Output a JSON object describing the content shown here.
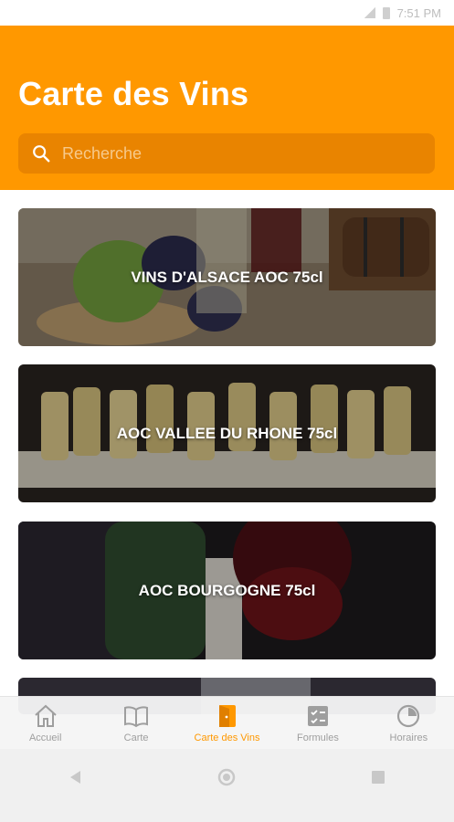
{
  "status_bar": {
    "time": "7:51 PM"
  },
  "header": {
    "title": "Carte des Vins",
    "search_placeholder": "Recherche",
    "color": "#ff9800"
  },
  "wine_categories": [
    {
      "label": "VINS D'ALSACE AOC 75cl",
      "image": "grapes-and-wine-glasses"
    },
    {
      "label": "AOC VALLEE DU RHONE 75cl",
      "image": "champagne-flutes"
    },
    {
      "label": "AOC BOURGOGNE 75cl",
      "image": "red-wine-glass-and-bottle"
    },
    {
      "label": "",
      "image": "wine-cellar"
    }
  ],
  "bottom_nav": {
    "items": [
      {
        "label": "Accueil",
        "icon": "home-icon",
        "active": false
      },
      {
        "label": "Carte",
        "icon": "open-book-icon",
        "active": false
      },
      {
        "label": "Carte des Vins",
        "icon": "wine-menu-icon",
        "active": true
      },
      {
        "label": "Formules",
        "icon": "checklist-icon",
        "active": false
      },
      {
        "label": "Horaires",
        "icon": "clock-icon",
        "active": false
      }
    ],
    "active_color": "#ff9800",
    "inactive_color": "#9e9e9e"
  },
  "system_nav": {
    "buttons": [
      "back-icon",
      "home-circle-icon",
      "recents-icon"
    ]
  }
}
